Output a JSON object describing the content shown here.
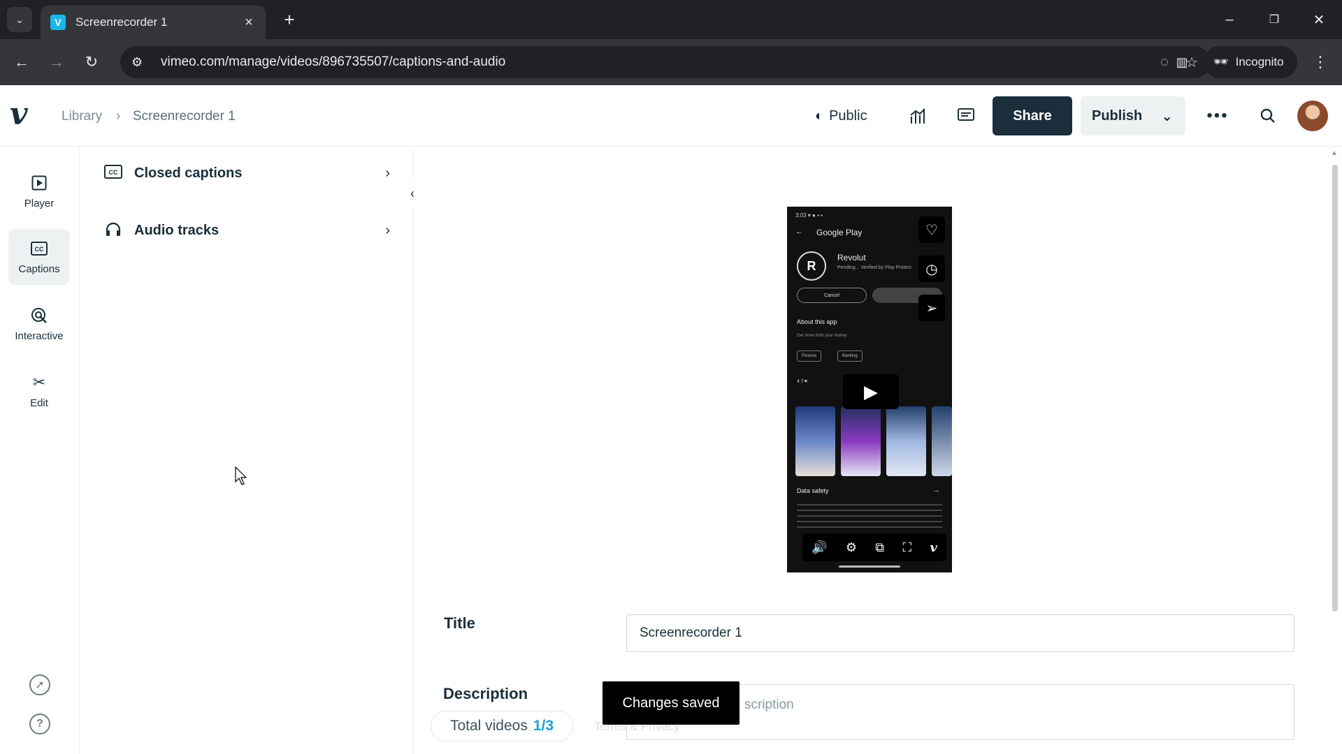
{
  "browser": {
    "tab_title": "Screenrecorder 1",
    "favicon_letter": "V",
    "url": "vimeo.com/manage/videos/896735507/captions-and-audio",
    "incognito_label": "Incognito"
  },
  "header": {
    "breadcrumb_library": "Library",
    "breadcrumb_current": "Screenrecorder 1",
    "privacy_label": "Public",
    "share_label": "Share",
    "publish_label": "Publish"
  },
  "rail": {
    "items": [
      {
        "label": "Player",
        "icon": "play-square-icon"
      },
      {
        "label": "Captions",
        "icon": "cc-icon"
      },
      {
        "label": "Interactive",
        "icon": "interactive-icon"
      },
      {
        "label": "Edit",
        "icon": "scissors-icon"
      }
    ]
  },
  "panel": {
    "items": [
      {
        "label": "Closed captions",
        "icon": "cc-icon"
      },
      {
        "label": "Audio tracks",
        "icon": "headphones-icon"
      }
    ]
  },
  "video_preview": {
    "store_label": "Google Play",
    "app_name": "Revolut",
    "app_status": "Pending... Verified by Play Protect",
    "cancel_label": "Cancel",
    "about_label": "About this app",
    "about_sub": "Get more from your money",
    "chips": [
      "Finance",
      "Banking"
    ],
    "rating": "4.7★",
    "data_safety_label": "Data safety"
  },
  "form": {
    "title_label": "Title",
    "title_value": "Screenrecorder 1",
    "description_label": "Description",
    "description_placeholder": "scription"
  },
  "toast": {
    "message": "Changes saved"
  },
  "footer": {
    "total_videos_label": "Total videos",
    "total_videos_count": "1/3",
    "terms_label": "Terms & Privacy"
  },
  "colors": {
    "brand_dark": "#1a2e3b",
    "accent": "#17a1d2",
    "favicon": "#1ab7ea"
  }
}
